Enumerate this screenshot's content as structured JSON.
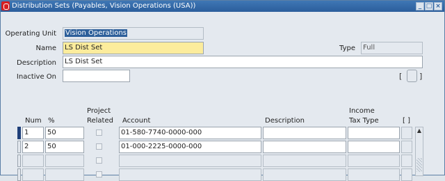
{
  "window": {
    "title": "Distribution Sets (Payables, Vision Operations (USA))",
    "controls": [
      "minimize-icon",
      "maximize-icon",
      "close-icon"
    ]
  },
  "header": {
    "operating_unit_label": "Operating Unit",
    "operating_unit_value": "Vision Operations",
    "name_label": "Name",
    "name_value": "LS Dist Set",
    "type_label": "Type",
    "type_value": "Full",
    "description_label": "Description",
    "description_value": "LS Dist Set",
    "inactive_on_label": "Inactive On",
    "inactive_on_value": "",
    "dff_bracket_left": "[",
    "dff_bracket_right": "]"
  },
  "lines": {
    "columns": {
      "num": "Num",
      "percent": "%",
      "project_related_line1": "Project",
      "project_related_line2": "Related",
      "account": "Account",
      "description": "Description",
      "income_tax_line1": "Income",
      "income_tax_line2": "Tax Type",
      "dff": "[ ]"
    },
    "rows": [
      {
        "num": "1",
        "percent": "50",
        "project_related": false,
        "account": "01-580-7740-0000-000",
        "description": "",
        "income_tax_type": ""
      },
      {
        "num": "2",
        "percent": "50",
        "project_related": false,
        "account": "01-000-2225-0000-000",
        "description": "",
        "income_tax_type": ""
      },
      {
        "num": "",
        "percent": "",
        "project_related": false,
        "account": "",
        "description": "",
        "income_tax_type": ""
      },
      {
        "num": "",
        "percent": "",
        "project_related": false,
        "account": "",
        "description": "",
        "income_tax_type": ""
      }
    ]
  },
  "colors": {
    "titlebar": "#2b5e9c",
    "required_field": "#fcec9c",
    "selection": "#2d5f9a",
    "current_record_indicator": "#1f3f79"
  }
}
